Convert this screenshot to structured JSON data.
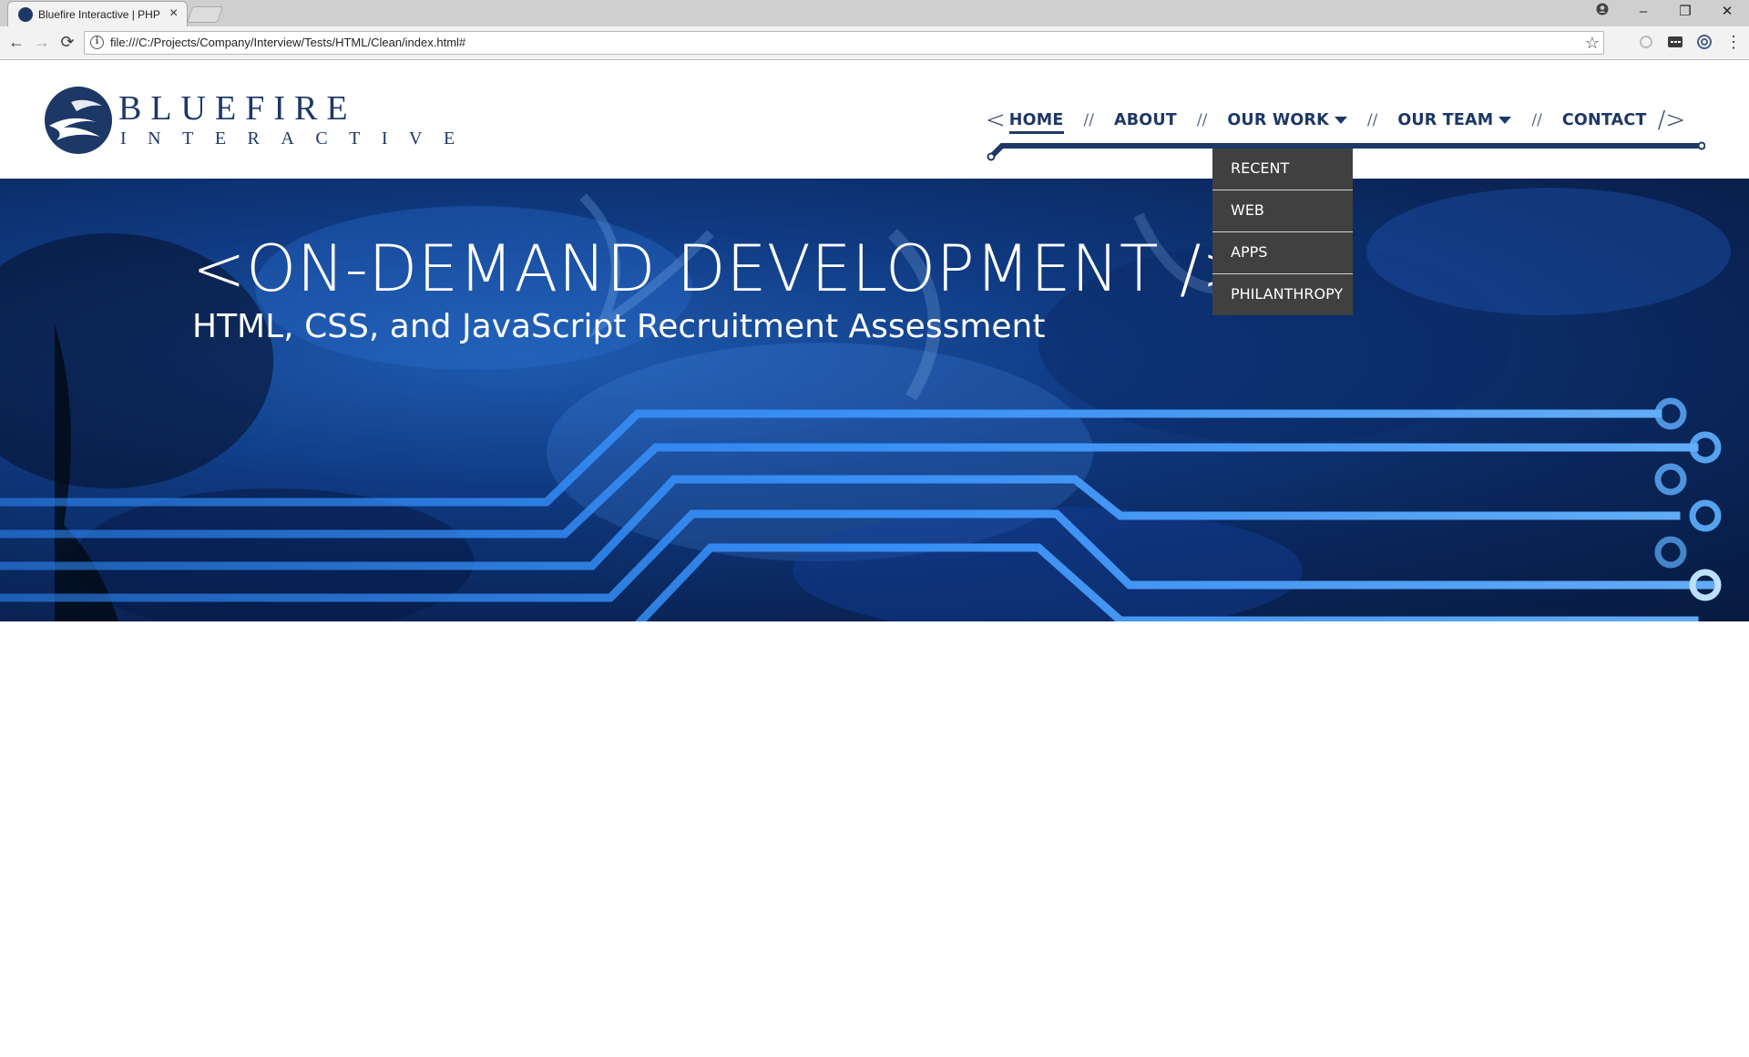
{
  "browser": {
    "tab_title": "Bluefire Interactive | PHP",
    "tab_close": "×",
    "url": "file:///C:/Projects/Company/Interview/Tests/HTML/Clean/index.html#",
    "controls": {
      "back": "←",
      "forward": "→",
      "reload": "⟳",
      "star": "☆",
      "menu": "⋮",
      "minimize": "–",
      "restore": "❐",
      "close": "✕"
    }
  },
  "logo": {
    "name": "BLUEFIRE",
    "subname": "INTERACTIVE"
  },
  "nav": {
    "open_bracket": "<",
    "close_bracket": "/>",
    "separator": "//",
    "items": [
      {
        "label": "HOME",
        "active": true
      },
      {
        "label": "ABOUT"
      },
      {
        "label": "OUR WORK",
        "has_dropdown": true
      },
      {
        "label": "OUR TEAM",
        "has_dropdown": true
      },
      {
        "label": "CONTACT"
      }
    ]
  },
  "dropdown": {
    "items": [
      "RECENT",
      "WEB",
      "APPS",
      "PHILANTHROPY"
    ]
  },
  "hero": {
    "title": "<ON-DEMAND DEVELOPMENT />",
    "subtitle": "HTML, CSS, and JavaScript Recruitment Assessment"
  },
  "colors": {
    "brand_navy": "#1d3866",
    "dropdown_bg": "#404040",
    "hero_blue": "#0f3a82",
    "circuit": "#2f8cff"
  }
}
